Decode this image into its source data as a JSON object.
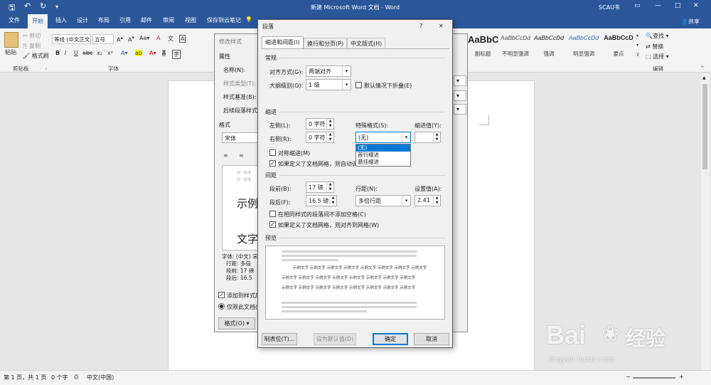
{
  "titlebar": {
    "doc_title": "新建 Microsoft Word 文档 - Word",
    "user": "SCAU韦",
    "share": "共享",
    "icons": [
      "save-icon",
      "undo-icon",
      "redo-icon",
      "customize-icon"
    ]
  },
  "tabs": [
    "文件",
    "开始",
    "插入",
    "设计",
    "布局",
    "引用",
    "邮件",
    "审阅",
    "视图",
    "保存到云笔记"
  ],
  "active_tab": "开始",
  "tell_me_icon": "lightbulb-icon",
  "ribbon": {
    "paste": "粘贴",
    "cut": "剪切",
    "copy": "复制",
    "format_painter": "格式刷",
    "clipboard_label": "剪贴板",
    "font_name": "等线 (中文正文)",
    "font_size": "五号",
    "font_label": "字体",
    "bold": "B",
    "italic": "I",
    "underline": "U",
    "styles": [
      {
        "sample": "AaBbC",
        "name": "副标题"
      },
      {
        "sample": "AaBbCcDd",
        "name": "不明显强调"
      },
      {
        "sample": "AaBbCcDd",
        "name": "强调"
      },
      {
        "sample": "AaBbCcDd",
        "name": "明显强调"
      },
      {
        "sample": "AaBbCcD",
        "name": "要点"
      }
    ],
    "find": "查找",
    "replace": "替换",
    "select": "选择",
    "edit_label": "编辑"
  },
  "modify_style": {
    "title": "修改样式",
    "props_label": "属性",
    "name_label": "名称(N):",
    "type_label": "样式类型(T):",
    "based_label": "样式基准(B):",
    "next_label": "后续段落样式(S):",
    "format_label": "格式",
    "font_value": "宋体",
    "preview_sample1": "示例",
    "preview_sample2": "文字",
    "preview_prev": "前一段落",
    "desc_lines": [
      "字体: (中文) 宋",
      "行距: 多倍",
      "段前: 17 磅",
      "段后: 16.5"
    ],
    "add_gallery": "添加到样式库",
    "only_doc": "仅限此文档(",
    "format_button": "格式(O)"
  },
  "paragraph": {
    "title": "段落",
    "help": "?",
    "close": "✕",
    "tabs": [
      "缩进和间距(I)",
      "换行和分页(P)",
      "中文版式(H)"
    ],
    "general": "常规",
    "alignment_label": "对齐方式(G):",
    "alignment_value": "两端对齐",
    "outline_label": "大纲级别(O):",
    "outline_value": "1 级",
    "collapse_label": "默认情况下折叠(E)",
    "indent": "缩进",
    "left_label": "左侧(L):",
    "left_value": "0 字符",
    "right_label": "右侧(R):",
    "right_value": "0 字符",
    "special_label": "特殊格式(S):",
    "special_value": "(无)",
    "indent_value_label": "缩进值(Y):",
    "special_options": [
      "(无)",
      "首行缩进",
      "悬挂缩进"
    ],
    "special_selected": "(无)",
    "mirror_label": "对称缩进(M)",
    "grid_indent_label": "如果定义了文档网格，则自动调",
    "spacing": "间距",
    "before_label": "段前(B):",
    "before_value": "17 磅",
    "after_label": "段后(F):",
    "after_value": "16.5 磅",
    "line_label": "行距(N):",
    "line_value": "多倍行距",
    "at_label": "设置值(A):",
    "at_value": "2.41",
    "no_space_label": "在相同样式的段落间不添加空格(C)",
    "snap_grid_label": "如果定义了文档网格，则对齐到网格(W)",
    "preview": "预览",
    "preview_sample": "示例文字 示例文字 示例文字 示例文字 示例文字 示例文字 示例文字 示例文字",
    "tabs_button": "制表位(T)...",
    "default_button": "设为默认值(D)",
    "ok_button": "确定",
    "cancel_button": "取消"
  },
  "statusbar": {
    "page": "第 1 页，共 1 页",
    "words": "0 个字",
    "lang": "中文(中国)"
  },
  "watermark": {
    "text": "Bai",
    "text2": "经验",
    "url": "jingyan.baidu.com"
  },
  "colors": {
    "word_blue": "#2b579a",
    "select_blue": "#0078d7"
  }
}
